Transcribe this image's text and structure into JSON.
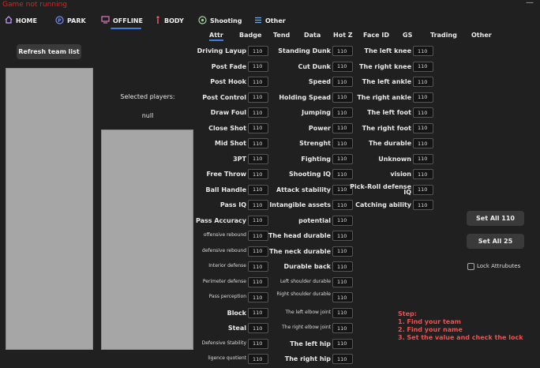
{
  "status": "Game not running",
  "nav": {
    "home": "HOME",
    "park": "PARK",
    "offline": "OFFLINE",
    "body": "BODY",
    "shooting": "Shooting",
    "other": "Other"
  },
  "tabs": [
    "Attr",
    "Badge",
    "Tend",
    "Data",
    "Hot Z",
    "Face ID",
    "GS",
    "Trading",
    "Other"
  ],
  "refresh_label": "Refresh team list",
  "selected_label": "Selected players:",
  "selected_value": "null",
  "col1": [
    {
      "label": "Driving Layup",
      "value": "110"
    },
    {
      "label": "Post Fade",
      "value": "110"
    },
    {
      "label": "Post Hook",
      "value": "110"
    },
    {
      "label": "Post Control",
      "value": "110"
    },
    {
      "label": "Draw Foul",
      "value": "110"
    },
    {
      "label": "Close Shot",
      "value": "110"
    },
    {
      "label": "Mid Shot",
      "value": "110"
    },
    {
      "label": "3PT",
      "value": "110"
    },
    {
      "label": "Free Throw",
      "value": "110"
    },
    {
      "label": "Ball Handle",
      "value": "110"
    },
    {
      "label": "Pass IQ",
      "value": "110"
    },
    {
      "label": "Pass Accuracy",
      "value": "110"
    },
    {
      "label": "offensive rebound",
      "value": "110"
    },
    {
      "label": "defensive rebound",
      "value": "110"
    },
    {
      "label": "Interior defense",
      "value": "110"
    },
    {
      "label": "Perimeter defense",
      "value": "110"
    },
    {
      "label": "Pass perception",
      "value": "110"
    },
    {
      "label": "Block",
      "value": "110"
    },
    {
      "label": "Steal",
      "value": "110"
    },
    {
      "label": "Defensive Stability",
      "value": "110"
    },
    {
      "label": "ligence quotient",
      "value": "110"
    }
  ],
  "col2": [
    {
      "label": "Standing Dunk",
      "value": "110"
    },
    {
      "label": "Cut Dunk",
      "value": "110"
    },
    {
      "label": "Speed",
      "value": "110"
    },
    {
      "label": "Holding Spead",
      "value": "110"
    },
    {
      "label": "Jumping",
      "value": "110"
    },
    {
      "label": "Power",
      "value": "110"
    },
    {
      "label": "Strenght",
      "value": "110"
    },
    {
      "label": "Fighting",
      "value": "110"
    },
    {
      "label": "Shooting IQ",
      "value": "110"
    },
    {
      "label": "Attack stability",
      "value": "110"
    },
    {
      "label": "Intangible assets",
      "value": "110"
    },
    {
      "label": "potential",
      "value": "110"
    },
    {
      "label": "The head durable",
      "value": "110"
    },
    {
      "label": "The neck durable",
      "value": "110"
    },
    {
      "label": "Durable back",
      "value": "110"
    },
    {
      "label": "Left shoulder durable",
      "value": "110"
    },
    {
      "label": "Right shoulder durable",
      "value": "110"
    },
    {
      "label": "The left elbow joint",
      "value": "110"
    },
    {
      "label": "The right elbow joint",
      "value": "110"
    },
    {
      "label": "The left hip",
      "value": "110"
    },
    {
      "label": "The right hip",
      "value": "110"
    }
  ],
  "col3": [
    {
      "label": "The left knee",
      "value": "110"
    },
    {
      "label": "The right knee",
      "value": "110"
    },
    {
      "label": "The left ankle",
      "value": "110"
    },
    {
      "label": "The right ankle",
      "value": "110"
    },
    {
      "label": "The left foot",
      "value": "110"
    },
    {
      "label": "The right foot",
      "value": "110"
    },
    {
      "label": "The durable",
      "value": "110"
    },
    {
      "label": "Unknown",
      "value": "110"
    },
    {
      "label": "vision",
      "value": "110"
    },
    {
      "label": "Pick-Roll defense IQ",
      "value": "110"
    },
    {
      "label": "Catching ability",
      "value": "110"
    }
  ],
  "set_all_110": "Set All 110",
  "set_all_25": "Set All 25",
  "lock_label": "Lock Attrubutes",
  "steps": {
    "title": "Step:",
    "s1": "1. Find your team",
    "s2": "2. Find your name",
    "s3": "3. Set the value and check the lock"
  }
}
